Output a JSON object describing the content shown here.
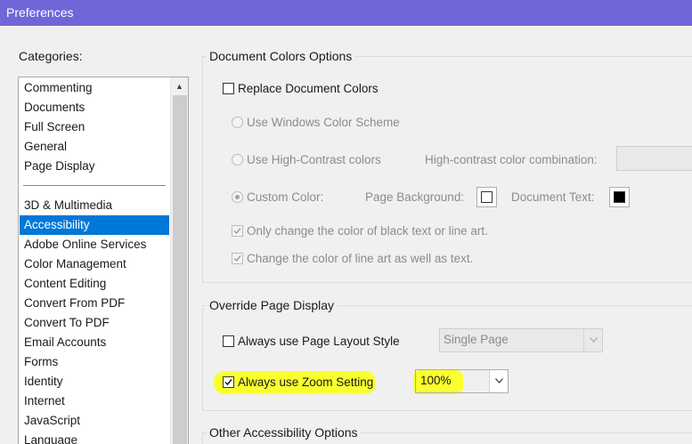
{
  "window": {
    "title": "Preferences"
  },
  "categories": {
    "label": "Categories:",
    "top_items": [
      "Commenting",
      "Documents",
      "Full Screen",
      "General",
      "Page Display"
    ],
    "items": [
      "3D & Multimedia",
      "Accessibility",
      "Adobe Online Services",
      "Color Management",
      "Content Editing",
      "Convert From PDF",
      "Convert To PDF",
      "Email Accounts",
      "Forms",
      "Identity",
      "Internet",
      "JavaScript",
      "Language"
    ],
    "selected": "Accessibility"
  },
  "document_colors": {
    "title": "Document Colors Options",
    "replace_label": "Replace Document Colors",
    "replace_checked": false,
    "windows_scheme_label": "Use Windows Color Scheme",
    "high_contrast_label": "Use High-Contrast colors",
    "high_contrast_combo_label": "High-contrast color combination:",
    "custom_color_label": "Custom Color:",
    "custom_color_selected": true,
    "page_background_label": "Page Background:",
    "page_background_color": "#ffffff",
    "document_text_label": "Document Text:",
    "document_text_color": "#000000",
    "only_black_label": "Only change the color of black text or line art.",
    "only_black_checked": true,
    "line_art_label": "Change the color of line art as well as text.",
    "line_art_checked": true
  },
  "override_page_display": {
    "title": "Override Page Display",
    "layout_style_label": "Always use Page Layout Style",
    "layout_style_checked": false,
    "layout_style_value": "Single Page",
    "zoom_label": "Always use Zoom Setting",
    "zoom_checked": true,
    "zoom_value": "100%",
    "highlight_color": "#faff2e"
  },
  "other_options": {
    "title": "Other Accessibility Options"
  },
  "colors": {
    "titlebar": "#6f66d9",
    "selection": "#0078d7"
  }
}
